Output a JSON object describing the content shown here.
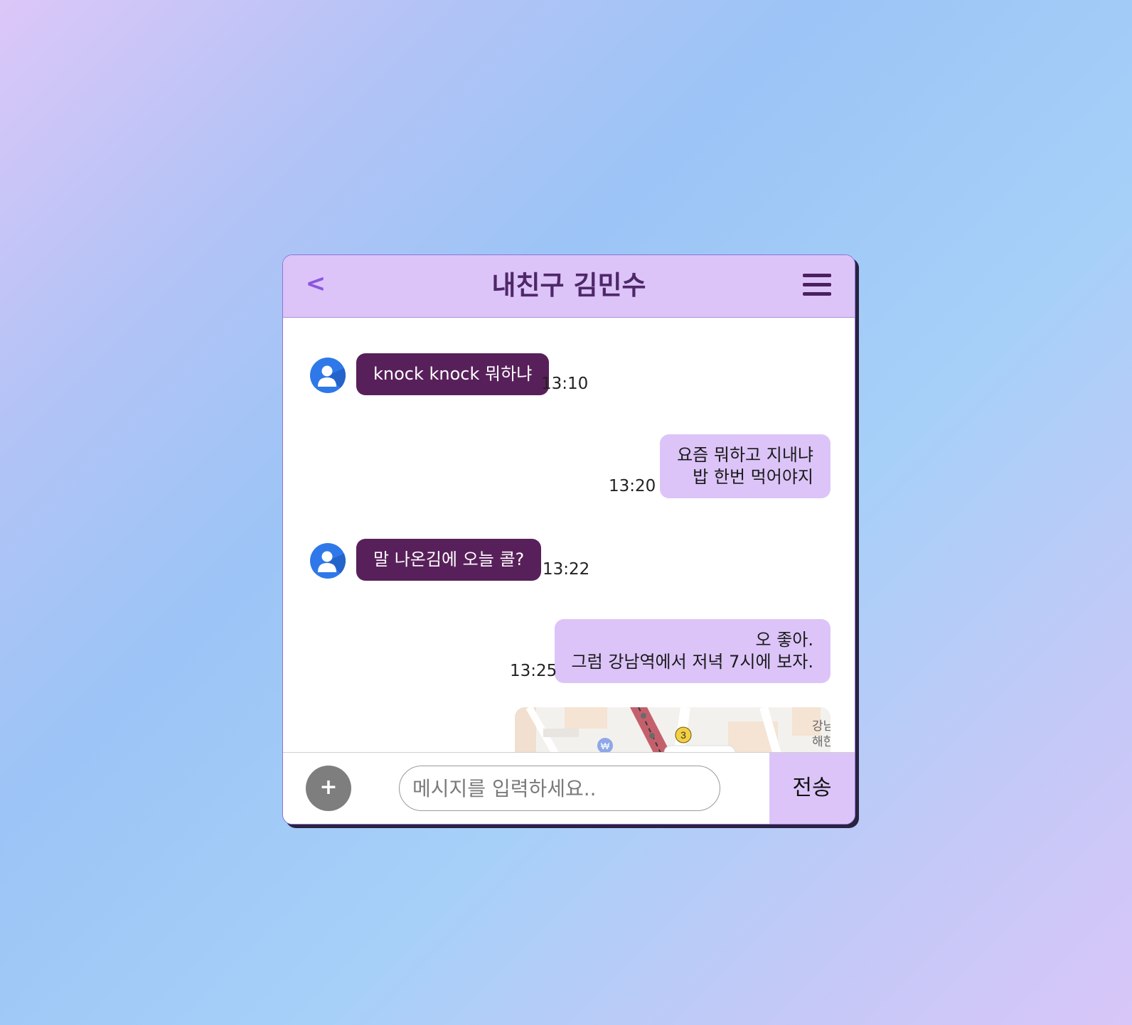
{
  "header": {
    "back_label": "<",
    "title": "내친구 김민수",
    "menu_icon": "hamburger-menu-icon"
  },
  "messages": [
    {
      "side": "received",
      "lines": [
        "knock knock 뭐하냐"
      ],
      "time": "13:10"
    },
    {
      "side": "sent",
      "lines": [
        "요즘 뭐하고 지내냐",
        "밥 한번 먹어야지"
      ],
      "time": "13:20"
    },
    {
      "side": "received",
      "lines": [
        "말 나온김에 오늘 콜?"
      ],
      "time": "13:22"
    },
    {
      "side": "sent",
      "lines": [
        "오 좋아.",
        "그럼 강남역에서 저녁 7시에 보자."
      ],
      "time": "13:25"
    }
  ],
  "map": {
    "visible_labels": [
      "강남",
      "해한"
    ],
    "station_marker": "3",
    "bank_icon": "won-currency-icon"
  },
  "input": {
    "add_label": "+",
    "placeholder": "메시지를 입력하세요..",
    "value": "",
    "send_label": "전송"
  },
  "colors": {
    "header_bg": "#dcc4f8",
    "title": "#4f2769",
    "received_bubble": "#58205a",
    "sent_bubble": "#dcc4f8",
    "avatar": "#2f78e9",
    "add_button": "#7e7e7e"
  }
}
